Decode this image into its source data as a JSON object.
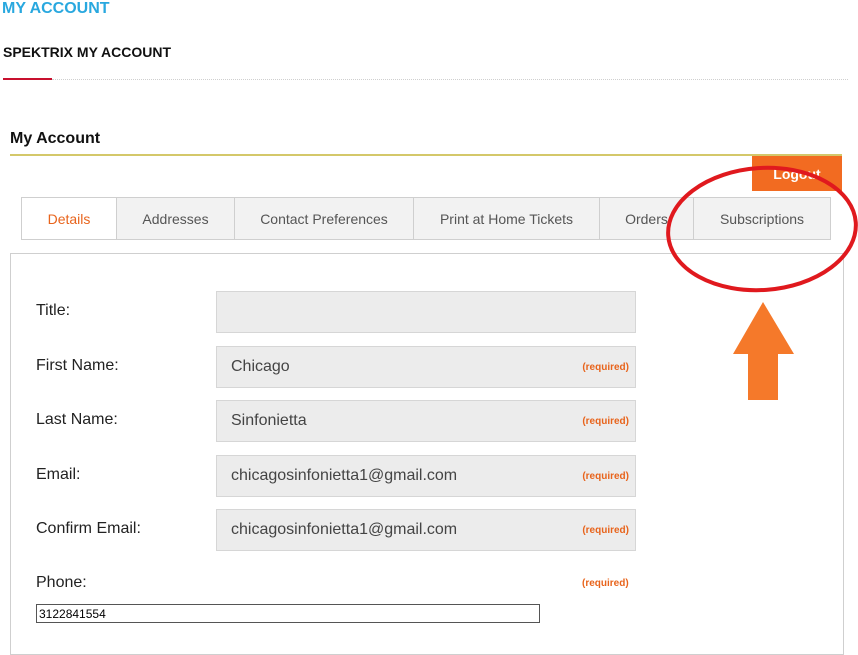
{
  "header": {
    "page_heading": "MY ACCOUNT",
    "site_subtitle": "SPEKTRIX MY ACCOUNT"
  },
  "account": {
    "section_title": "My Account",
    "logout_label": "Logout"
  },
  "tabs": [
    {
      "label": "Details",
      "active": true
    },
    {
      "label": "Addresses",
      "active": false
    },
    {
      "label": "Contact Preferences",
      "active": false
    },
    {
      "label": "Print at Home Tickets",
      "active": false
    },
    {
      "label": "Orders",
      "active": false
    },
    {
      "label": "Subscriptions",
      "active": false
    }
  ],
  "form": {
    "required_label": "(required)",
    "title": {
      "label": "Title:",
      "value": ""
    },
    "first_name": {
      "label": "First Name:",
      "value": "Chicago"
    },
    "last_name": {
      "label": "Last Name:",
      "value": "Sinfonietta"
    },
    "email": {
      "label": "Email:",
      "value": "chicagosinfonietta1@gmail.com"
    },
    "confirm_email": {
      "label": "Confirm Email:",
      "value": "chicagosinfonietta1@gmail.com"
    },
    "phone": {
      "label": "Phone:",
      "value": "3122841554"
    }
  },
  "colors": {
    "heading_blue": "#29a8df",
    "accent_orange": "#f26b21",
    "annotation_red": "#e0191e",
    "annotation_arrow": "#f5792a"
  },
  "annotation": {
    "circle_target": "Subscriptions tab",
    "arrow_icon": "up-arrow-icon"
  }
}
